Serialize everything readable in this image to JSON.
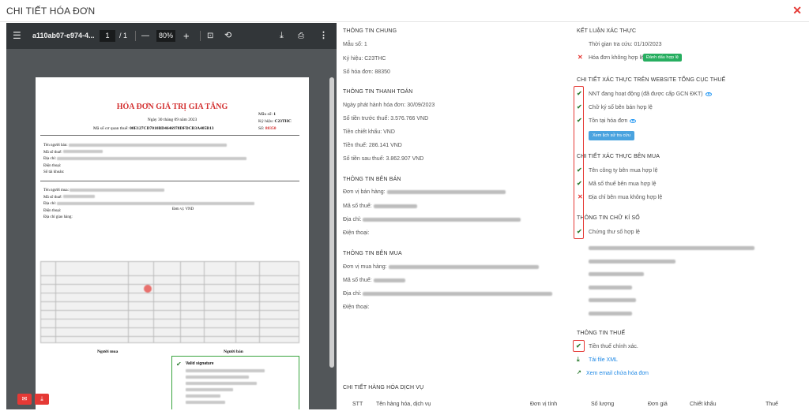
{
  "modal": {
    "title": "CHI TIẾT HÓA ĐƠN",
    "close_icon": "close-icon"
  },
  "viewer": {
    "file_name": "a110ab07-e974-4...",
    "page_current": "1",
    "page_total": "/ 1",
    "zoom": "80%",
    "zoom_out": "—",
    "zoom_in": "+"
  },
  "invoice": {
    "title": "HÓA ĐƠN GIÁ TRỊ GIA TĂNG",
    "date": "Ngày 30 tháng 09 năm 2023",
    "tax_code_label": "Mã số cơ quan thuế:",
    "tax_code": "00E127CD7010BD4646978DFDCB3A405B13",
    "mau_so_label": "Mẫu số:",
    "mau_so": "1",
    "ky_hieu_label": "Ký hiệu:",
    "ky_hieu": "C23THC",
    "so_label": "Số:",
    "so": "88350",
    "seller_labels": [
      "Tên người bán:",
      "Mã số thuế:",
      "Địa chỉ:",
      "Điện thoại:",
      "Số tài khoản:"
    ],
    "buyer_labels": [
      "Tên người mua:",
      "Mã số thuế:",
      "Địa chỉ:",
      "Điện thoại:",
      "Địa chỉ giao hàng:"
    ],
    "currency_label": "Đơn vị: VND",
    "buyer_sign": "Người mua",
    "seller_sign": "Người bán",
    "signature_status": "Valid signature"
  },
  "general": {
    "heading": "THÔNG TIN CHUNG",
    "rows": [
      {
        "label": "Mẫu số:",
        "value": "1"
      },
      {
        "label": "Ký hiệu:",
        "value": "C23THC"
      },
      {
        "label": "Số hóa đơn:",
        "value": "88350"
      }
    ]
  },
  "payment": {
    "heading": "THÔNG TIN THANH TOÁN",
    "rows": [
      {
        "label": "Ngày phát hành hóa đơn:",
        "value": "30/09/2023"
      },
      {
        "label": "Số tiền trước thuế:",
        "value": "3.576.766 VND"
      },
      {
        "label": "Tiền chiết khấu:",
        "value": "VND"
      },
      {
        "label": "Tiền thuế:",
        "value": "286.141 VND"
      },
      {
        "label": "Số tiền sau thuế:",
        "value": "3.862.907 VND"
      }
    ]
  },
  "seller": {
    "heading": "THÔNG TIN BÊN BÁN",
    "rows": [
      {
        "label": "Đơn vị bán hàng:"
      },
      {
        "label": "Mã số thuế:"
      },
      {
        "label": "Địa chỉ:"
      },
      {
        "label": "Điện thoại:"
      }
    ]
  },
  "buyer": {
    "heading": "THÔNG TIN BÊN MUA",
    "rows": [
      {
        "label": "Đơn vị mua hàng:"
      },
      {
        "label": "Mã số thuế:"
      },
      {
        "label": "Địa chỉ:"
      },
      {
        "label": "Điện thoại:"
      }
    ]
  },
  "conclusion": {
    "heading": "KẾT LUẬN XÁC THỰC",
    "lookup_time": "Thời gian tra cứu: 01/10/2023",
    "status": "Hóa đơn không hợp lệ",
    "mark_button": "Đánh dấu hợp lệ"
  },
  "website_check": {
    "heading": "CHI TIẾT XÁC THỰC TRÊN WEBSITE TỔNG CỤC THUẾ",
    "items": [
      {
        "label": "NNT đang hoạt động (đã được cấp GCN ĐKT)",
        "ok": true
      },
      {
        "label": "Chữ ký số bên bán hợp lệ",
        "ok": true
      },
      {
        "label": "Tồn tại hóa đơn",
        "ok": true
      }
    ],
    "lookup_button": "Xem lịch sử tra cứu"
  },
  "buyer_check": {
    "heading": "CHI TIẾT XÁC THỰC BÊN MUA",
    "items": [
      {
        "label": "Tên công ty bên mua hợp lệ",
        "ok": true
      },
      {
        "label": "Mã số thuế bên mua hợp lệ",
        "ok": true
      },
      {
        "label": "Địa chỉ bên mua không hợp lệ",
        "ok": false
      }
    ]
  },
  "signature": {
    "heading": "THÔNG TIN CHỮ KÍ SỐ",
    "status": "Chứng thư số hợp lệ"
  },
  "tax": {
    "heading": "THÔNG TIN THUẾ",
    "status": "Tiền thuế chính xác.",
    "download_xml": "Tải file XML",
    "view_email": "Xem email chứa hóa đơn"
  },
  "goods": {
    "heading": "CHI TIẾT HÀNG HÓA DỊCH VỤ",
    "columns": [
      "STT",
      "Tên hàng hóa, dịch vụ",
      "Đơn vị tính",
      "Số lượng",
      "Đơn giá",
      "Chiết khấu",
      "Thuế"
    ]
  },
  "colors": {
    "accent_red": "#e53935",
    "ok_green": "#2e7d32",
    "badge_green": "#27ae60",
    "link_blue": "#1e88e5"
  }
}
